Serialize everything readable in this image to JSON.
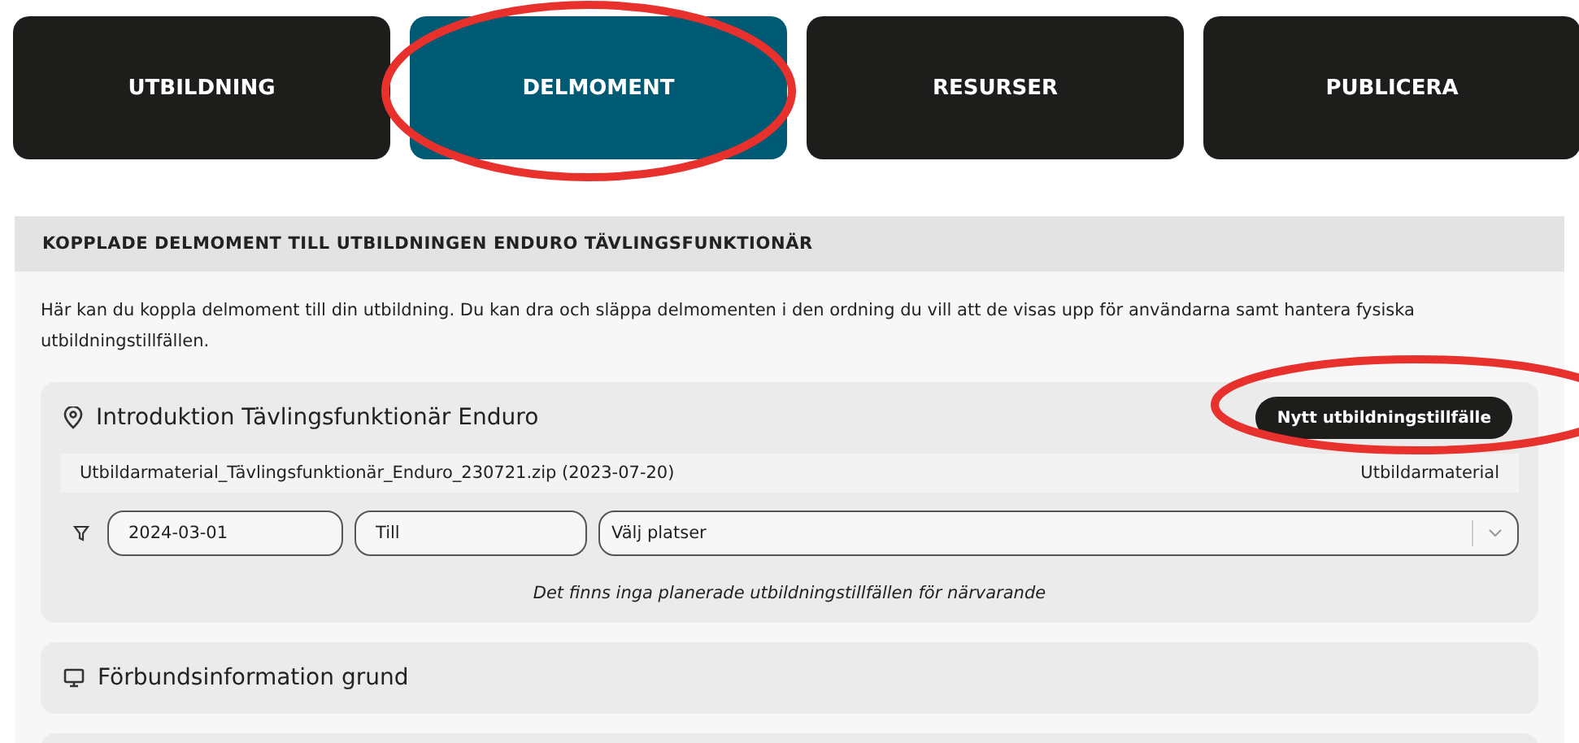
{
  "tabs": [
    {
      "label": "UTBILDNING",
      "selected": false
    },
    {
      "label": "DELMOMENT",
      "selected": true
    },
    {
      "label": "RESURSER",
      "selected": false
    },
    {
      "label": "PUBLICERA",
      "selected": false
    }
  ],
  "panel": {
    "title": "KOPPLADE DELMOMENT TILL UTBILDNINGEN ENDURO TÄVLINGSFUNKTIONÄR",
    "description": "Här kan du koppla delmoment till din utbildning. Du kan dra och släppa delmomenten i den ordning du vill att de visas upp för användarna samt hantera fysiska utbildningstillfällen.",
    "items": [
      {
        "kind": "location",
        "title": "Introduktion Tävlingsfunktionär Enduro",
        "button": "Nytt utbildningstillfälle",
        "file": {
          "name": "Utbildarmaterial_Tävlingsfunktionär_Enduro_230721.zip (2023-07-20)",
          "type": "Utbildarmaterial"
        },
        "filter": {
          "from": "2024-03-01",
          "to_placeholder": "Till",
          "places_placeholder": "Välj platser"
        },
        "empty_message": "Det finns inga planerade utbildningstillfällen för närvarande"
      },
      {
        "kind": "screen",
        "title": "Förbundsinformation grund"
      }
    ]
  }
}
